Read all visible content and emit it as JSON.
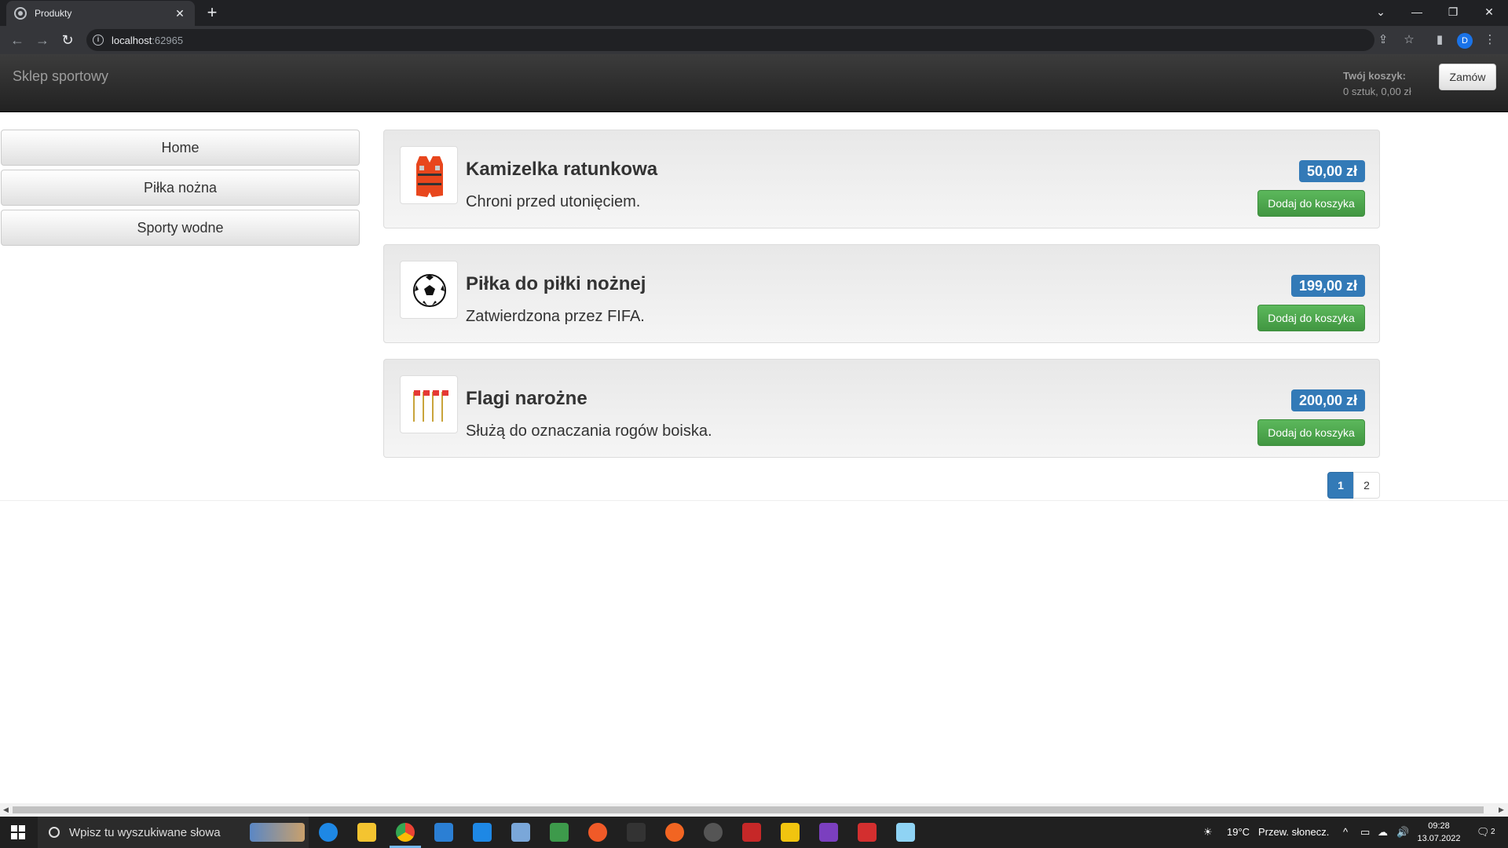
{
  "browser": {
    "tab_title": "Produkty",
    "tab_close": "✕",
    "new_tab": "+",
    "url_host": "localhost",
    "url_port": ":62965"
  },
  "shop": {
    "brand": "Sklep sportowy",
    "cart_title": "Twój koszyk:",
    "cart_summary": "0 sztuk, 0,00 zł",
    "order_label": "Zamów"
  },
  "categories": [
    {
      "label": "Home"
    },
    {
      "label": "Piłka nożna"
    },
    {
      "label": "Sporty wodne"
    }
  ],
  "products": [
    {
      "name": "Kamizelka ratunkowa",
      "description": "Chroni przed utonięciem.",
      "price": "50,00 zł",
      "button": "Dodaj do koszyka",
      "icon": "life-vest-icon"
    },
    {
      "name": "Piłka do piłki nożnej",
      "description": "Zatwierdzona przez FIFA.",
      "price": "199,00 zł",
      "button": "Dodaj do koszyka",
      "icon": "soccer-ball-icon"
    },
    {
      "name": "Flagi narożne",
      "description": "Służą do oznaczania rogów boiska.",
      "price": "200,00 zł",
      "button": "Dodaj do koszyka",
      "icon": "corner-flags-icon"
    }
  ],
  "pagination": {
    "pages": [
      "1",
      "2"
    ],
    "current": "1"
  },
  "taskbar": {
    "search_placeholder": "Wpisz tu wyszukiwane słowa",
    "weather_temp": "19°C",
    "weather_text": "Przew. słonecz.",
    "time": "09:28",
    "date": "13.07.2022",
    "notifications": "2"
  },
  "colors": {
    "primary": "#337ab7",
    "success": "#5cb85c",
    "navbar": "#222222"
  }
}
